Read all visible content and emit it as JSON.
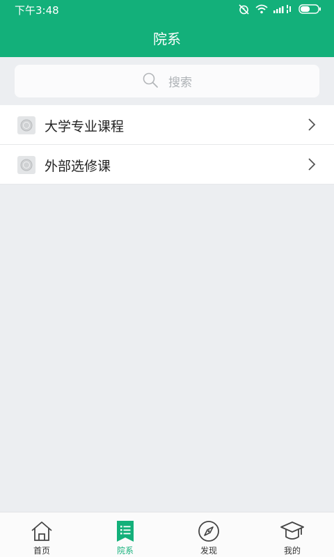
{
  "status_bar": {
    "time": "下午3:48"
  },
  "header": {
    "title": "院系"
  },
  "search": {
    "placeholder": "搜索"
  },
  "list": {
    "items": [
      {
        "label": "大学专业课程"
      },
      {
        "label": "外部选修课"
      }
    ]
  },
  "tabbar": {
    "tabs": [
      {
        "label": "首页",
        "icon": "home-icon"
      },
      {
        "label": "院系",
        "icon": "list-bookmark-icon",
        "active": true
      },
      {
        "label": "发现",
        "icon": "compass-icon"
      },
      {
        "label": "我的",
        "icon": "graduation-cap-icon"
      }
    ]
  },
  "colors": {
    "brand": "#13b07a",
    "background": "#eceef1"
  }
}
